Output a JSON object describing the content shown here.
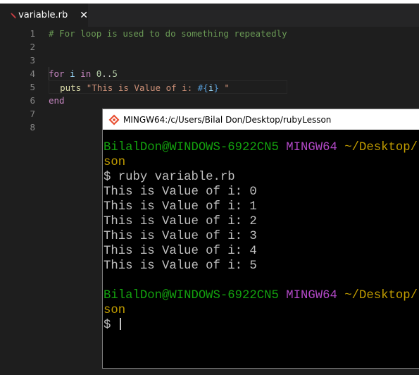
{
  "editor": {
    "tab": {
      "title": "variable.rb",
      "close_glyph": "✕",
      "icon": "ruby-file-icon"
    },
    "line_numbers": [
      "1",
      "2",
      "3",
      "4",
      "5",
      "6",
      "7",
      "8"
    ],
    "code": {
      "line1": {
        "comment": "# For loop is used to do something repeatedly"
      },
      "line4": {
        "kw_for": "for",
        "var": "i",
        "kw_in": "in",
        "range_start": "0",
        "range_op": "..",
        "range_end": "5"
      },
      "line5": {
        "fn": "puts",
        "str_open": "\"This is Value of i: ",
        "interp_open": "#{",
        "interp_var": "i",
        "interp_close": "}",
        "str_close": " \""
      },
      "line6": {
        "kw_end": "end"
      }
    }
  },
  "terminal": {
    "title": "MINGW64:/c/Users/Bilal Don/Desktop/rubyLesson",
    "icon": "git-bash-icon",
    "prompt1": {
      "user": "BilalDon@WINDOWS-6922CN5",
      "host": "MINGW64",
      "path": "~/Desktop/rubyLes",
      "path_wrap": "son"
    },
    "command_line": "$ ruby variable.rb",
    "output": [
      "This is Value of i: 0",
      "This is Value of i: 1",
      "This is Value of i: 2",
      "This is Value of i: 3",
      "This is Value of i: 4",
      "This is Value of i: 5"
    ],
    "prompt2": {
      "user": "BilalDon@WINDOWS-6922CN5",
      "host": "MINGW64",
      "path": "~/Desktop/rubyLes",
      "path_wrap": "son"
    },
    "input_prompt": "$ "
  },
  "colors": {
    "editor_bg": "#1e1e1e",
    "terminal_bg": "#000000",
    "prompt_user": "#13a10e",
    "prompt_host": "#b148c6",
    "prompt_path": "#c19c00"
  }
}
